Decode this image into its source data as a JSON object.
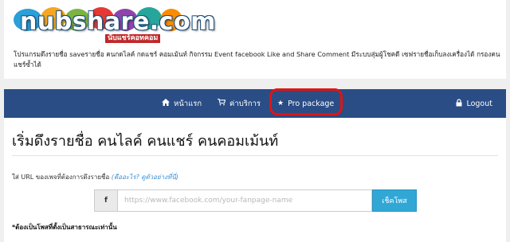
{
  "header": {
    "logo_text": "nubshare.com",
    "logo_sub": "นับแชร์คอทคอม",
    "description": "โปรแกรมดึงรายชื่อ saveรายชื่อ คนกดไลค์ กดแชร์ คอมเม้นท์ กิจกรรม Event facebook Like and Share Comment มีระบบสุ่มผู้โชคดี เซฟรายชื่อเก็บลงเครื่องได้ กรองคนแชร์ซ้ำได้"
  },
  "nav": {
    "home_label": "หน้าแรก",
    "service_label": "ค่าบริการ",
    "pro_label": "Pro package",
    "logout_label": "Logout",
    "highlight_color": "#e01414",
    "bar_color": "#2a4d86"
  },
  "main": {
    "title": "เริ่มดึงรายชื่อ คนไลค์ คนแชร์ คนคอมเม้นท์",
    "url_label": "ใส่ URL ของเพจที่ต้องการดึงรายชื่อ ",
    "url_hint": "(คืออะไร? ดูตัวอย่างที่นี่)",
    "fb_icon": "f",
    "url_placeholder": "https://www.facebook.com/your-fanpage-name",
    "check_button": "เช็คโพส",
    "note": "*ต้องเป็นโพสที่ตั้งเป็นสาธารณะเท่านั้น",
    "button_color": "#31a7d6"
  }
}
